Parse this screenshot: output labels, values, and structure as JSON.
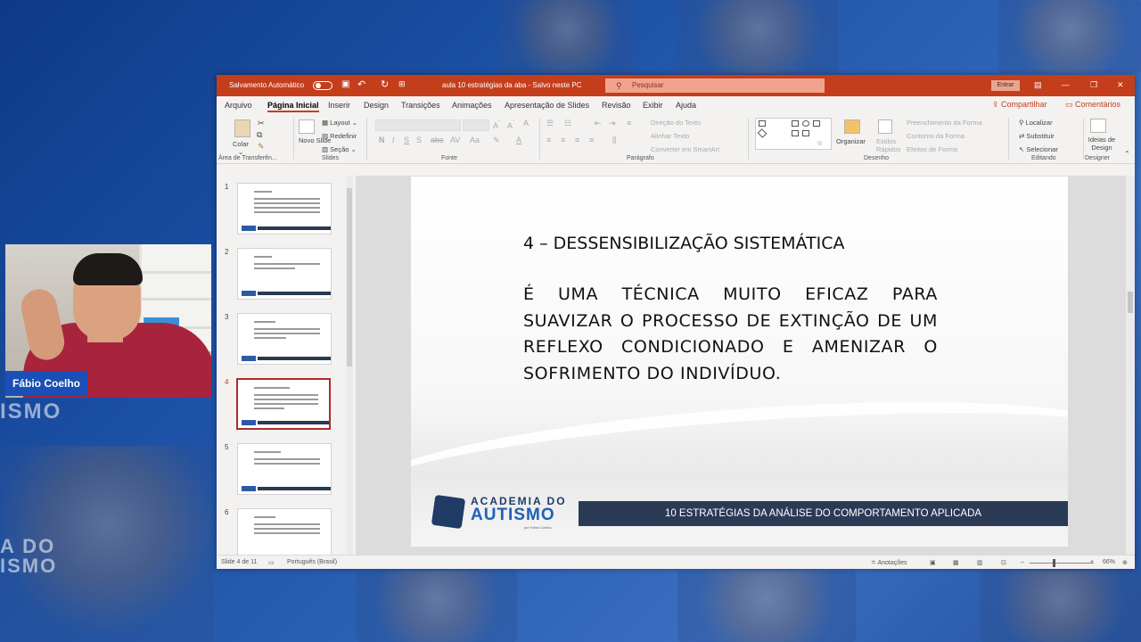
{
  "background": {
    "text_left_1": "ISMO",
    "text_left_2": "A DO",
    "text_left_3": "ISMO"
  },
  "webcam": {
    "presenter_name": "Fábio Coelho"
  },
  "titlebar": {
    "autosave_label": "Salvamento Automático",
    "document_title": "aula 10 estratégias da aba  -  Salvo neste PC",
    "search_placeholder": "Pesquisar",
    "signin_label": "Entrar",
    "minimize": "—",
    "restore": "❐",
    "close": "✕"
  },
  "menu": {
    "tabs": [
      "Arquivo",
      "Página Inicial",
      "Inserir",
      "Design",
      "Transições",
      "Animações",
      "Apresentação de Slides",
      "Revisão",
      "Exibir",
      "Ajuda"
    ],
    "active_tab": "Página Inicial",
    "share": "Compartilhar",
    "comments": "Comentários"
  },
  "ribbon": {
    "paste": "Colar",
    "clipboard_group": "Área de Transferên...",
    "new_slide": "Novo Slide",
    "layout": "Layout",
    "reset": "Redefinir",
    "section": "Seção",
    "slides_group": "Slides",
    "font_group": "Fonte",
    "paragraph_group": "Parágrafo",
    "text_direction": "Direção do Texto",
    "align_text": "Alinhar Texto",
    "smartart": "Converter em SmartArt",
    "arrange": "Organizar",
    "quick_styles": "Estilos Rápidos",
    "shape_fill": "Preenchimento da Forma",
    "shape_outline": "Contorno da Forma",
    "shape_effects": "Efeitos de Forma",
    "drawing_group": "Desenho",
    "find": "Localizar",
    "replace": "Substituir",
    "select": "Selecionar",
    "editing_group": "Editando",
    "design_ideas": "Ideias de Design",
    "designer_group": "Designer"
  },
  "thumbnails": [
    {
      "num": "1"
    },
    {
      "num": "2"
    },
    {
      "num": "3"
    },
    {
      "num": "4"
    },
    {
      "num": "5"
    },
    {
      "num": "6"
    }
  ],
  "active_slide_index": 4,
  "slide": {
    "title": "4 – DESSENSIBILIZAÇÃO SISTEMÁTICA",
    "body": "É UMA TÉCNICA MUITO EFICAZ PARA SUAVIZAR O PROCESSO DE EXTINÇÃO DE UM REFLEXO CONDICIONADO E AMENIZAR O SOFRIMENTO DO INDIVÍDUO.",
    "footer": "10 ESTRATÉGIAS DA ANÁLISE DO COMPORTAMENTO APLICADA",
    "logo_line1": "ACADEMIA DO",
    "logo_line2": "AUTISMO",
    "logo_line3": "por Fábio Coelho"
  },
  "statusbar": {
    "slide_count": "Slide 4 de 11",
    "language": "Português (Brasil)",
    "notes": "Anotações",
    "zoom": "66%"
  }
}
